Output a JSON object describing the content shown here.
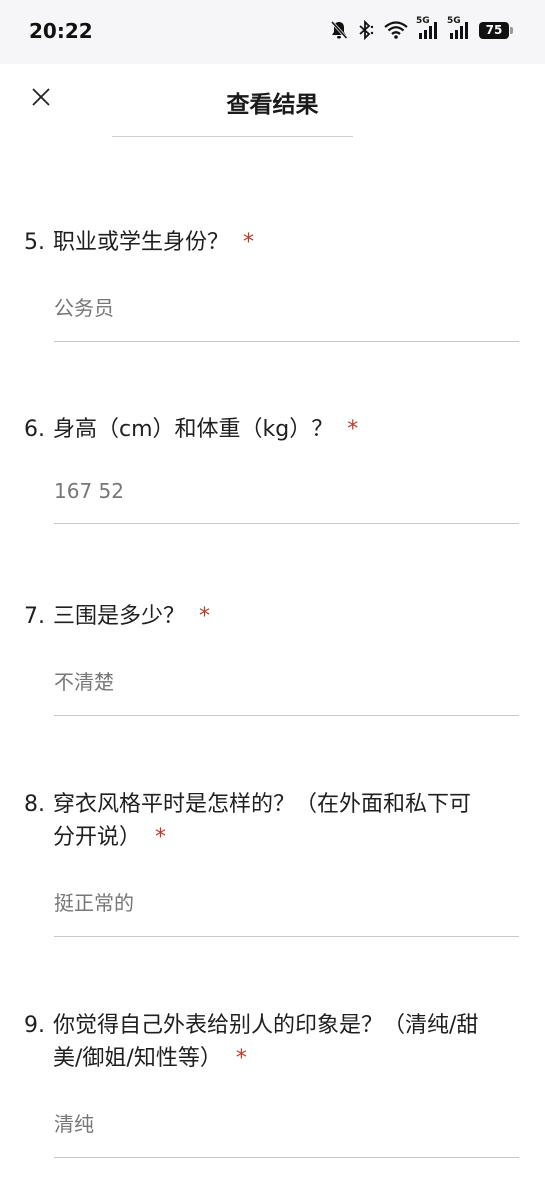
{
  "status_bar": {
    "time": "20:22",
    "signal_label_1": "5G",
    "signal_label_2": "5G",
    "battery": "75",
    "icons": [
      "mute-bell-icon",
      "bluetooth-icon",
      "wifi-icon",
      "signal-5g-icon",
      "signal-5g-icon",
      "battery-icon"
    ]
  },
  "header": {
    "title": "查看结果",
    "close_icon": "close-icon"
  },
  "questions": [
    {
      "num": "5.",
      "text": "职业或学生身份？",
      "required": "*",
      "answer": "公务员"
    },
    {
      "num": "6.",
      "text": "身高（cm）和体重（kg）？",
      "required": "*",
      "answer": "167 52"
    },
    {
      "num": "7.",
      "text": "三围是多少？",
      "required": "*",
      "answer": "不清楚"
    },
    {
      "num": "8.",
      "text": "穿衣风格平时是怎样的？（在外面和私下可分开说）",
      "required": "*",
      "answer": "挺正常的"
    },
    {
      "num": "9.",
      "text": "你觉得自己外表给别人的印象是？（清纯/甜美/御姐/知性等）",
      "required": "*",
      "answer": "清纯"
    }
  ],
  "colors": {
    "required_star": "#c0392b",
    "status_bar_bg": "#f6f6f8"
  }
}
